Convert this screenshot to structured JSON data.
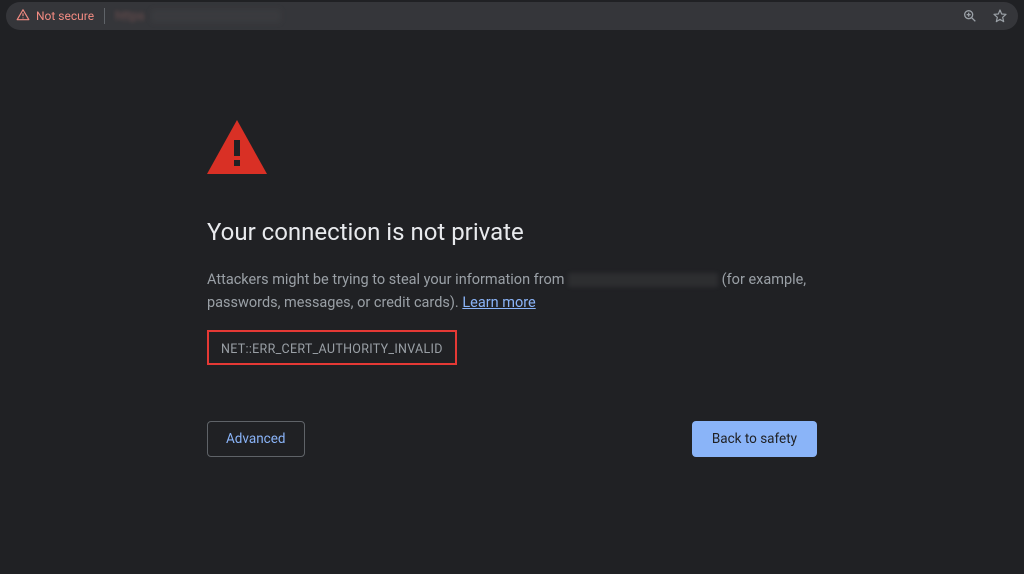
{
  "omnibox": {
    "not_secure_label": "Not secure",
    "url_scheme": "https",
    "url_host_redacted": true
  },
  "interstitial": {
    "heading": "Your connection is not private",
    "body_prefix": "Attackers might be trying to steal your information from ",
    "body_suffix": " (for example, passwords, messages, or credit cards). ",
    "learn_more_label": "Learn more",
    "error_code": "NET::ERR_CERT_AUTHORITY_INVALID",
    "advanced_label": "Advanced",
    "back_to_safety_label": "Back to safety"
  }
}
